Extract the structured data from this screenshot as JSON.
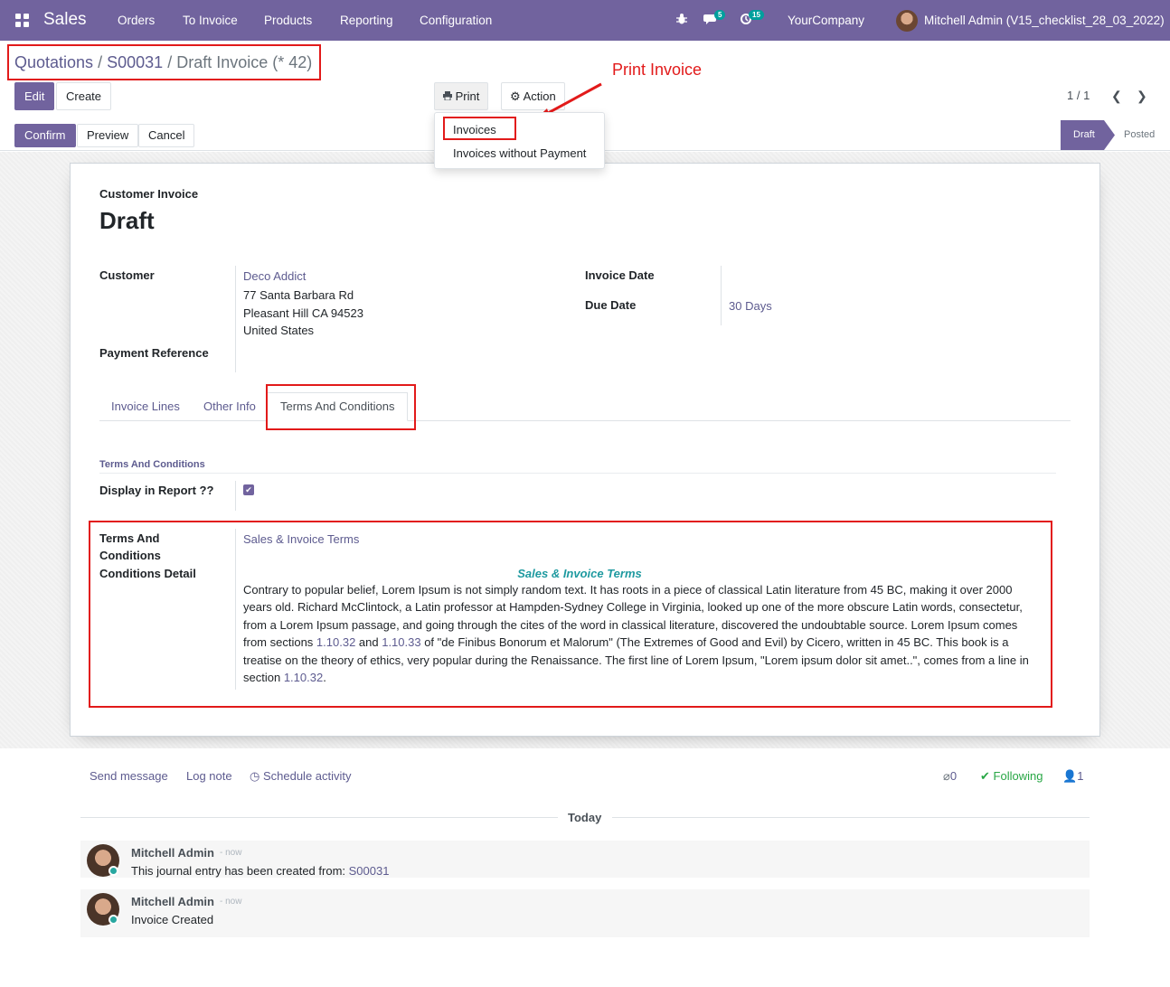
{
  "topbar": {
    "app_name": "Sales",
    "menu": [
      "Orders",
      "To Invoice",
      "Products",
      "Reporting",
      "Configuration"
    ],
    "messages_count": "5",
    "activities_count": "15",
    "company": "YourCompany",
    "user": "Mitchell Admin (V15_checklist_28_03_2022)"
  },
  "breadcrumb": {
    "item1": "Quotations",
    "sep": "/",
    "item2": "S00031",
    "current": "Draft Invoice (* 42)"
  },
  "buttons": {
    "edit": "Edit",
    "create": "Create",
    "print": "Print",
    "action": "Action",
    "confirm": "Confirm",
    "preview": "Preview",
    "cancel": "Cancel"
  },
  "print_menu": {
    "invoices": "Invoices",
    "invoices_without_payment": "Invoices without Payment"
  },
  "annotation": "Print Invoice",
  "pager": "1 / 1",
  "status": {
    "draft": "Draft",
    "posted": "Posted"
  },
  "form": {
    "type": "Customer Invoice",
    "title": "Draft",
    "customer_label": "Customer",
    "customer_name": "Deco Addict",
    "address1": "77 Santa Barbara Rd",
    "address2": "Pleasant Hill CA 94523",
    "address3": "United States",
    "payment_ref_label": "Payment Reference",
    "invoice_date_label": "Invoice Date",
    "due_date_label": "Due Date",
    "due_date_value": "30 Days"
  },
  "tabs": [
    "Invoice Lines",
    "Other Info",
    "Terms And Conditions"
  ],
  "terms": {
    "section_title": "Terms And Conditions",
    "display_label": "Display in Report ??",
    "display_checked": true,
    "tc_label_line1": "Terms And",
    "tc_label_line2": "Conditions",
    "tc_detail_label": "Conditions Detail",
    "tc_value": "Sales & Invoice Terms",
    "detail_heading": "Sales & Invoice Terms",
    "p1": "Contrary to popular belief, Lorem Ipsum is not simply random text. It has roots in a piece of classical Latin literature from 45 BC, making it over 2000 years old. Richard McClintock, a Latin professor at Hampden-Sydney College in Virginia, looked up one of the more obscure Latin words, consectetur, from a Lorem Ipsum passage, and going through the cites of the word in classical literature, discovered the undoubtable source. Lorem Ipsum comes from sections ",
    "ref1": "1.10.32",
    "and": " and ",
    "ref2": "1.10.33",
    "p2": " of \"de Finibus Bonorum et Malorum\" (The Extremes of Good and Evil) by Cicero, written in 45 BC. This book is a treatise on the theory of ethics, very popular during the Renaissance. The first line of Lorem Ipsum, \"Lorem ipsum dolor sit amet..\", comes from a line in section ",
    "ref3": "1.10.32",
    "end": "."
  },
  "chatter": {
    "send_message": "Send message",
    "log_note": "Log note",
    "schedule_activity": "Schedule activity",
    "attachments": "0",
    "following": "Following",
    "followers": "1",
    "today": "Today",
    "messages": [
      {
        "author": "Mitchell Admin",
        "date": "- now",
        "body": "This journal entry has been created from: ",
        "link": "S00031"
      },
      {
        "author": "Mitchell Admin",
        "date": "- now",
        "body": "Invoice Created",
        "link": ""
      }
    ]
  },
  "colors": {
    "brand": "#71639e",
    "annotation_red": "#e21a1a",
    "heading_teal": "#1f9aa0"
  }
}
